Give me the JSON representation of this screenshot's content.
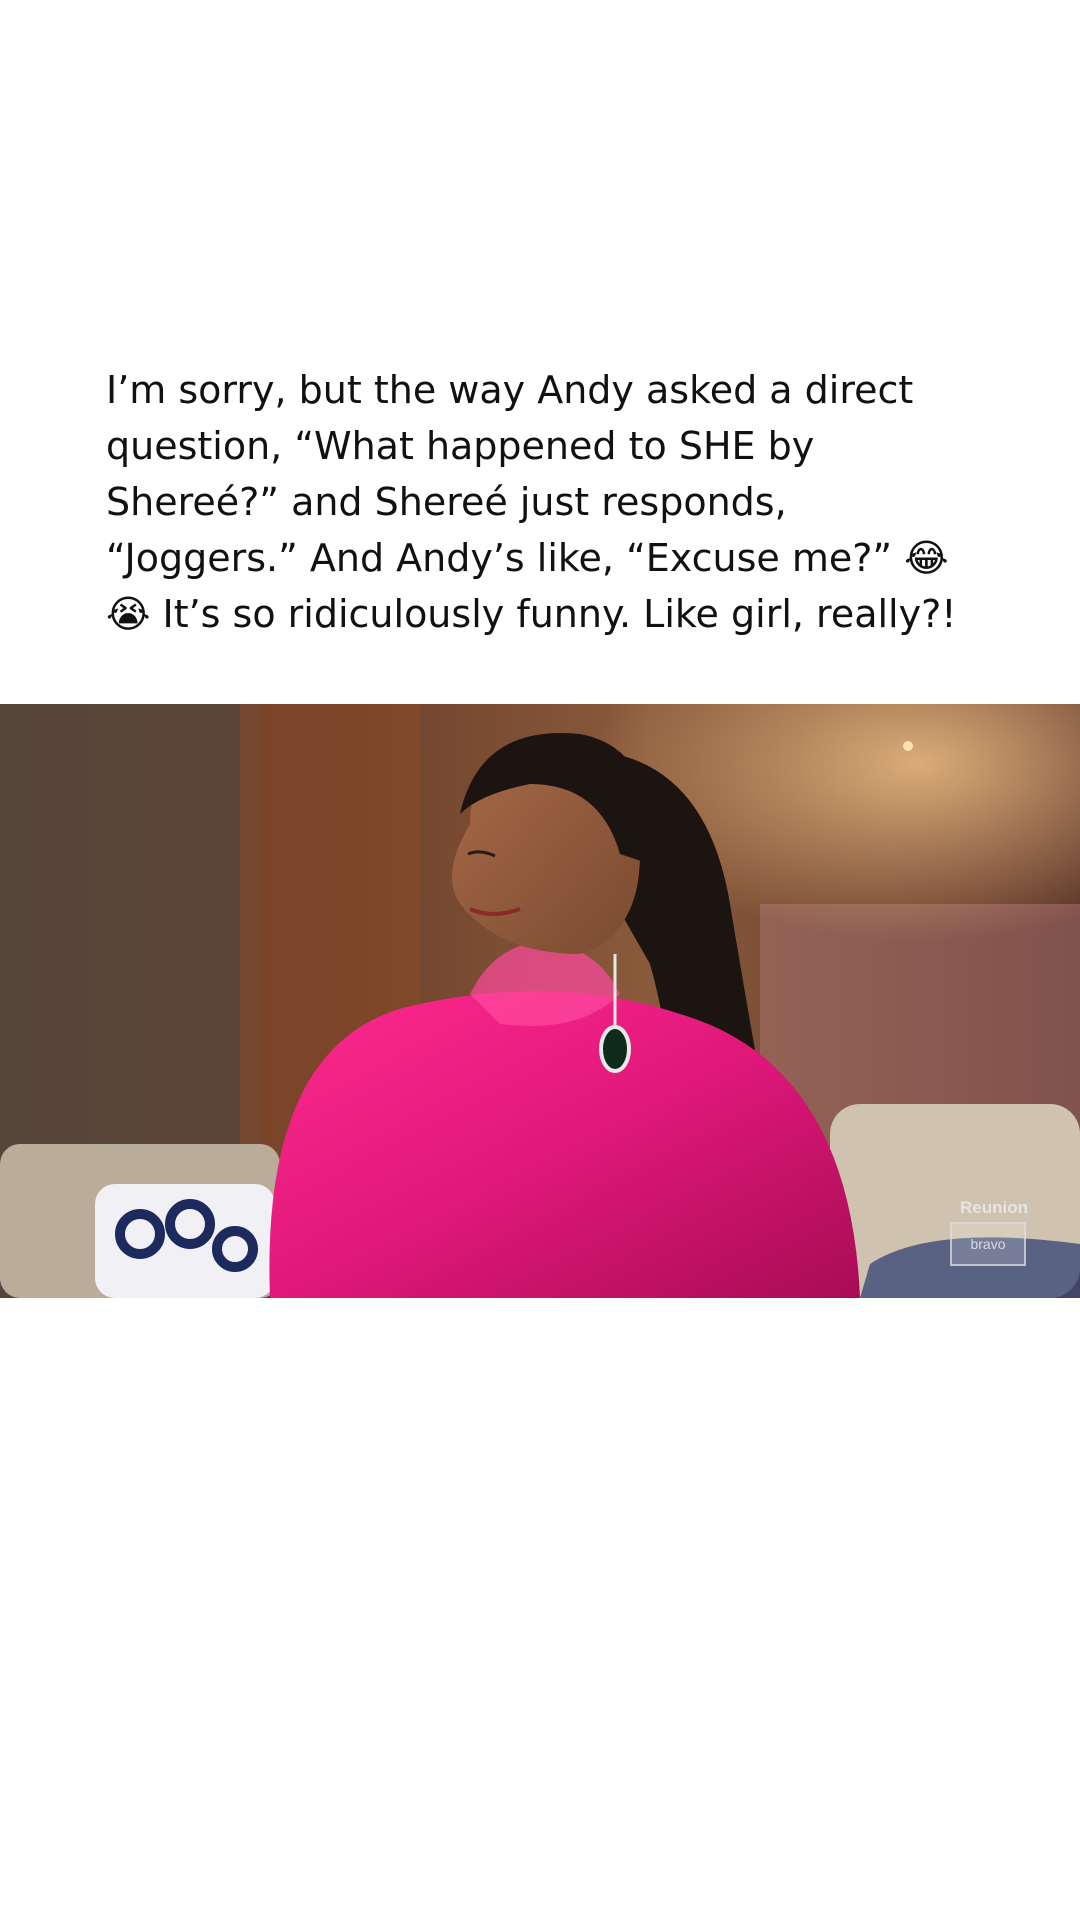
{
  "post": {
    "caption_lines": [
      "I’m sorry, but the way Andy asked a direct",
      "question, “What happened to SHE by",
      "Shereé?” and Shereé just responds,",
      "“Joggers.” And Andy’s like, “Excuse me?” 😂",
      "😭 It’s so ridiculously funny. Like girl, really?!"
    ]
  },
  "video": {
    "watermark": "Reunion",
    "network_logo": "bravo"
  },
  "colors": {
    "background": "#ffffff",
    "text": "#111111",
    "dress": "#e0187a",
    "backdrop": "#6b3a2c"
  }
}
